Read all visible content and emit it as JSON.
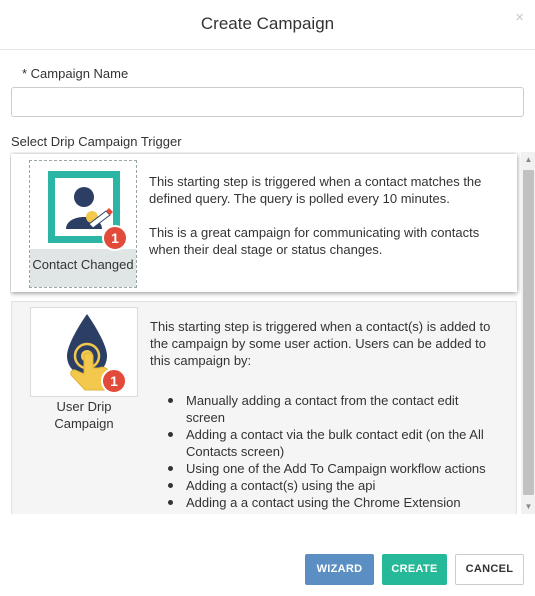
{
  "dialog": {
    "title": "Create Campaign",
    "close_icon": "×"
  },
  "form": {
    "name_label": "* Campaign Name",
    "name_value": "",
    "name_placeholder": "",
    "trigger_label": "Select Drip Campaign Trigger"
  },
  "triggers": [
    {
      "label": "Contact Changed",
      "icon": "contact-changed-icon",
      "badge": "1",
      "selected": true,
      "paragraphs": [
        "This starting step is triggered when a contact matches the defined query. The query is polled every 10 minutes.",
        "This is a great campaign for communicating with contacts when their deal stage or status changes."
      ]
    },
    {
      "label": "User Drip Campaign",
      "icon": "user-drip-icon",
      "badge": "1",
      "selected": false,
      "paragraphs": [
        "This starting step is triggered when a contact(s) is added to the campaign by some user action. Users can be added to this campaign by:"
      ],
      "bullets": [
        "Manually adding a contact from the contact edit screen",
        "Adding a contact via the bulk contact edit (on the All Contacts screen)",
        "Using one of the Add To Campaign workflow actions",
        "Adding a contact(s) using the api",
        "Adding a a contact using the Chrome Extension"
      ]
    }
  ],
  "scrollbar": {
    "up_arrow": "▲",
    "down_arrow": "▼"
  },
  "buttons": {
    "wizard": "WIZARD",
    "create": "CREATE",
    "cancel": "CANCEL"
  },
  "colors": {
    "wizard": "#5b8ec3",
    "create": "#26b999",
    "badge": "#e24a3a",
    "frame_teal": "#2bb5a5",
    "hand_yellow": "#f2c94c",
    "drop_navy": "#2c3e63"
  }
}
